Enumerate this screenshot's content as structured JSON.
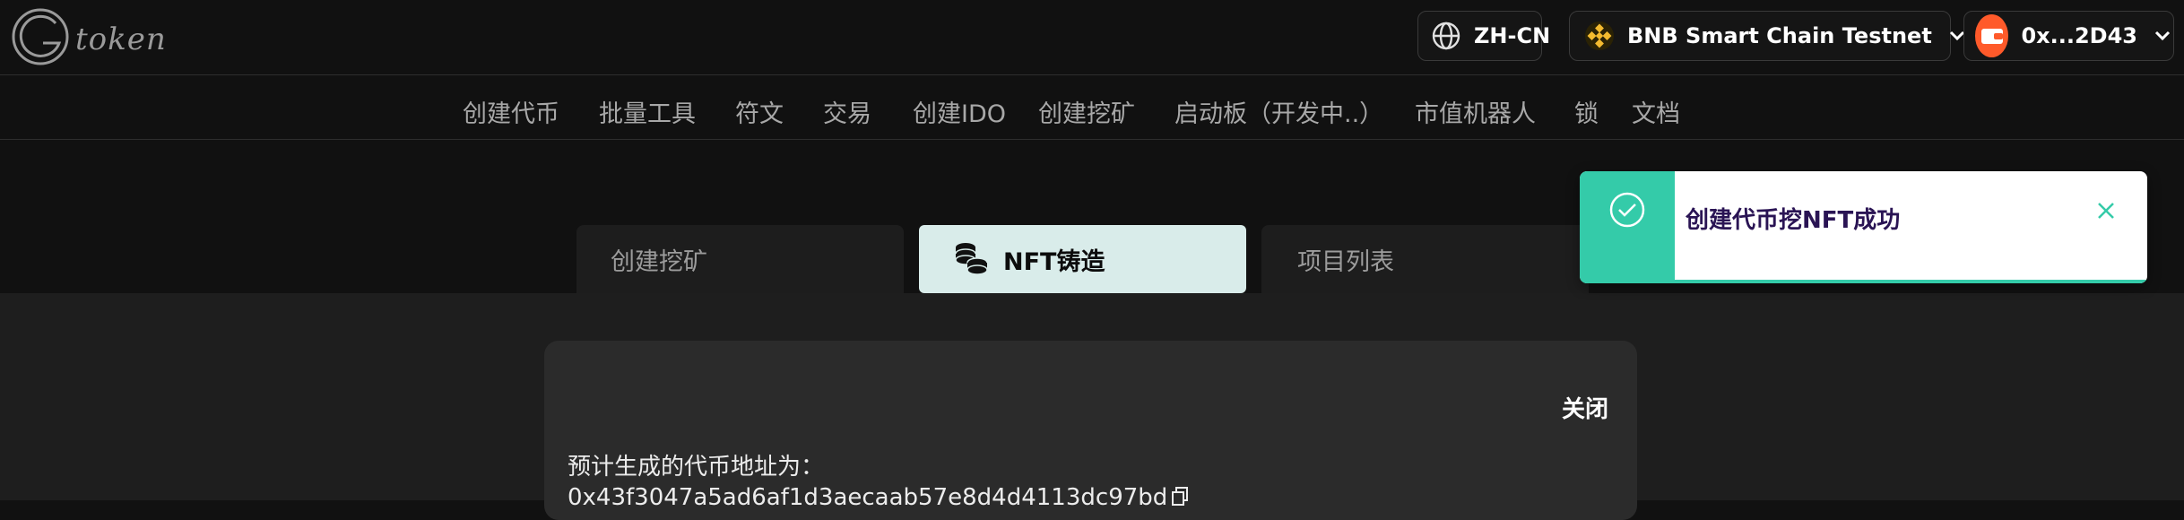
{
  "brand": {
    "logo_text": "token"
  },
  "header": {
    "language": "ZH-CN",
    "chain": "BNB Smart Chain Testnet",
    "wallet": "0x...2D43"
  },
  "nav": {
    "items": [
      "创建代币",
      "批量工具",
      "符文",
      "交易",
      "创建IDO",
      "创建挖矿",
      "启动板（开发中..）",
      "市值机器人",
      "锁",
      "文档"
    ]
  },
  "tabs": {
    "create_mining": "创建挖矿",
    "nft_mint": "NFT铸造",
    "project_list": "项目列表"
  },
  "panel": {
    "close_label": "关闭",
    "predict_label": "预计生成的代币地址为：",
    "predict_address": "0x43f3047a5ad6af1d3aecaab57e8d4d4113dc97bd"
  },
  "toast": {
    "message": "创建代币挖NFT成功"
  },
  "colors": {
    "accent": "#34cba9",
    "tab_active_bg": "#d9ecea",
    "wallet_icon": "#ff5a2a",
    "toast_text": "#2a1454"
  },
  "icons": {
    "language": "globe-icon",
    "chain": "bnb-icon",
    "wallet": "wallet-icon",
    "dropdown": "chevron-down-icon",
    "nft_tab": "coins-icon",
    "copy": "copy-icon",
    "toast_ok": "check-circle-icon",
    "toast_close": "close-icon"
  }
}
